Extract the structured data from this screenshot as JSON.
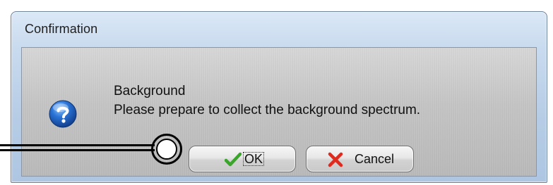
{
  "window": {
    "title": "Confirmation"
  },
  "message": {
    "icon": "question-icon",
    "title": "Background",
    "body": "Please prepare to collect the background spectrum."
  },
  "buttons": {
    "ok": {
      "label": "OK",
      "icon": "checkmark-icon",
      "icon_color": "#3aa52b"
    },
    "cancel": {
      "label": "Cancel",
      "icon": "x-icon",
      "icon_color": "#e12a1e"
    }
  },
  "annotation": {
    "type": "callout-pointer",
    "target": "ok-button"
  }
}
